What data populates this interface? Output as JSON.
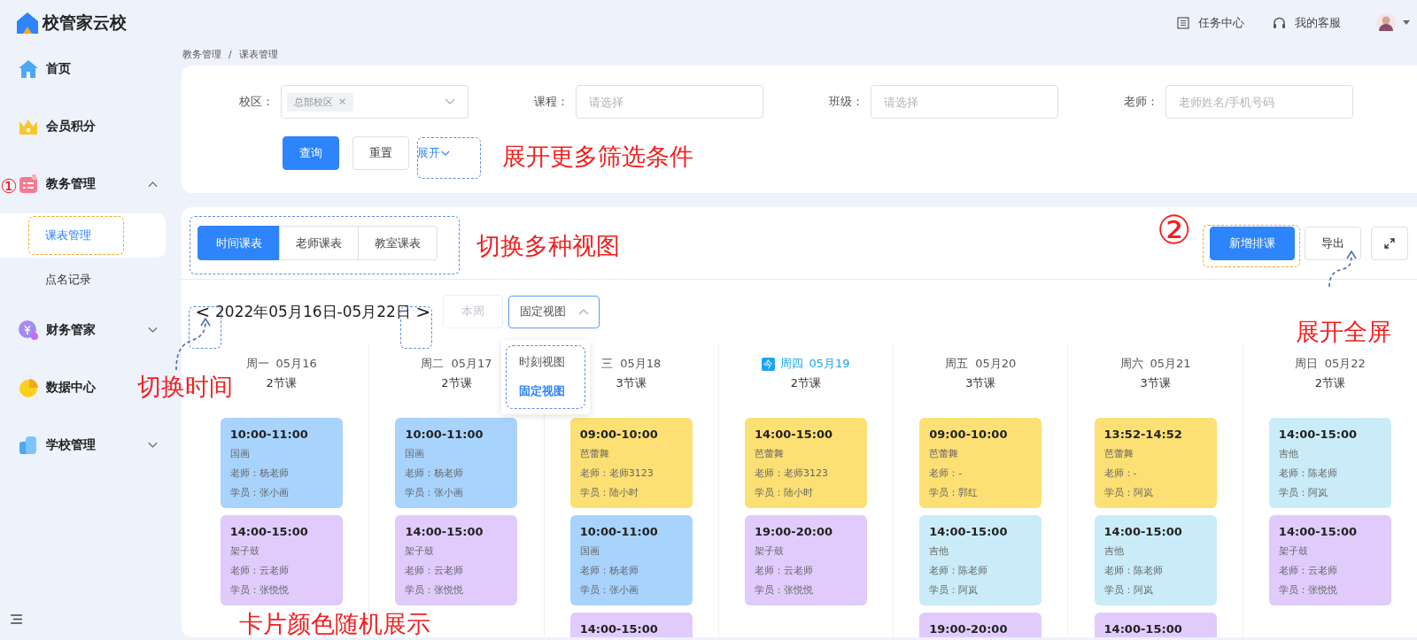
{
  "app": {
    "logo": "校管家云校"
  },
  "header": {
    "links": [
      "任务中心",
      "我的客服"
    ]
  },
  "sidebar": {
    "items": [
      {
        "label": "首页"
      },
      {
        "label": "会员积分"
      },
      {
        "label": "教务管理",
        "expanded": true,
        "children": [
          {
            "label": "课表管理",
            "selected": true
          },
          {
            "label": "点名记录",
            "selected": false
          }
        ]
      },
      {
        "label": "财务管家",
        "expanded": false
      },
      {
        "label": "数据中心"
      },
      {
        "label": "学校管理",
        "expanded": false
      }
    ]
  },
  "breadcrumb": [
    "教务管理",
    "课表管理"
  ],
  "breadcrumb_separator": "/",
  "filters": {
    "fields": [
      {
        "label": "校区：",
        "tag": "总部校区",
        "tag_close": "×"
      },
      {
        "label": "课程：",
        "placeholder": "请选择"
      },
      {
        "label": "班级：",
        "placeholder": "请选择"
      },
      {
        "label": "老师：",
        "placeholder": "老师姓名/手机号码"
      }
    ],
    "query": "查询",
    "reset": "重置",
    "expand": "展开"
  },
  "view_tabs": [
    {
      "label": "时间课表",
      "selected": true
    },
    {
      "label": "老师课表",
      "selected": false
    },
    {
      "label": "教室课表",
      "selected": false
    }
  ],
  "actions": {
    "add": "新增排课",
    "export": "导出"
  },
  "week": {
    "prev": "<",
    "range": "2022年05月16日-05月22日",
    "next": ">",
    "this_week": "本周",
    "this_week_disabled": true
  },
  "view_select": {
    "value": "固定视图",
    "expanded": true,
    "options": [
      {
        "label": "时刻视图",
        "selected": false
      },
      {
        "label": "固定视图",
        "selected": true
      }
    ]
  },
  "calendar": {
    "today_badge": "今",
    "days": [
      {
        "weekday": "周一",
        "date": "05月16",
        "count": "2节课",
        "today": false,
        "lessons": [
          {
            "time": "10:00-11:00",
            "course": "国画",
            "teacher": "老师：杨老师",
            "student": "学员：张小画",
            "color": "#a8d3fd"
          },
          {
            "time": "14:00-15:00",
            "course": "架子鼓",
            "teacher": "老师：云老师",
            "student": "学员：张悦悦",
            "color": "#e0cbfc"
          }
        ]
      },
      {
        "weekday": "周二",
        "date": "05月17",
        "count": "2节课",
        "today": false,
        "lessons": [
          {
            "time": "10:00-11:00",
            "course": "国画",
            "teacher": "老师：杨老师",
            "student": "学员：张小画",
            "color": "#a8d3fd"
          },
          {
            "time": "14:00-15:00",
            "course": "架子鼓",
            "teacher": "老师：云老师",
            "student": "学员：张悦悦",
            "color": "#e0cbfc"
          }
        ]
      },
      {
        "weekday": "三",
        "date": "05月18",
        "count": "3节课",
        "today": false,
        "lessons": [
          {
            "time": "09:00-10:00",
            "course": "芭蕾舞",
            "teacher": "老师：老师3123",
            "student": "学员：陆小时",
            "color": "#fde073"
          },
          {
            "time": "10:00-11:00",
            "course": "国画",
            "teacher": "老师：杨老师",
            "student": "学员：张小画",
            "color": "#a8d3fd"
          },
          {
            "time": "14:00-15:00",
            "color": "#e0cbfc"
          }
        ]
      },
      {
        "weekday": "周四",
        "date": "05月19",
        "count": "2节课",
        "today": true,
        "lessons": [
          {
            "time": "14:00-15:00",
            "course": "芭蕾舞",
            "teacher": "老师：老师3123",
            "student": "学员：陆小时",
            "color": "#fde073"
          },
          {
            "time": "19:00-20:00",
            "course": "架子鼓",
            "teacher": "老师：云老师",
            "student": "学员：张悦悦",
            "color": "#e0cbfc"
          }
        ]
      },
      {
        "weekday": "周五",
        "date": "05月20",
        "count": "3节课",
        "today": false,
        "lessons": [
          {
            "time": "09:00-10:00",
            "course": "芭蕾舞",
            "teacher": "老师：-",
            "student": "学员：郭红",
            "color": "#fde073"
          },
          {
            "time": "14:00-15:00",
            "course": "吉他",
            "teacher": "老师：陈老师",
            "student": "学员：阿岚",
            "color": "#c9ecf8"
          },
          {
            "time": "19:00-20:00",
            "color": "#e0cbfc"
          }
        ]
      },
      {
        "weekday": "周六",
        "date": "05月21",
        "count": "3节课",
        "today": false,
        "lessons": [
          {
            "time": "13:52-14:52",
            "course": "芭蕾舞",
            "teacher": "老师：-",
            "student": "学员：阿岚",
            "color": "#fde073"
          },
          {
            "time": "14:00-15:00",
            "course": "吉他",
            "teacher": "老师：陈老师",
            "student": "学员：阿岚",
            "color": "#c9ecf8"
          },
          {
            "time": "14:00-15:00",
            "color": "#e0cbfc"
          }
        ]
      },
      {
        "weekday": "周日",
        "date": "05月22",
        "count": "2节课",
        "today": false,
        "lessons": [
          {
            "time": "14:00-15:00",
            "course": "吉他",
            "teacher": "老师：陈老师",
            "student": "学员：阿岚",
            "color": "#c9ecf8"
          },
          {
            "time": "14:00-15:00",
            "course": "架子鼓",
            "teacher": "老师：云老师",
            "student": "学员：张悦悦",
            "color": "#e0cbfc"
          }
        ]
      }
    ]
  },
  "annotations": [
    "①",
    "展开更多筛选条件",
    "切换多种视图",
    "②",
    "展开全屏",
    "切换时间",
    "卡片颜色随机展示"
  ]
}
